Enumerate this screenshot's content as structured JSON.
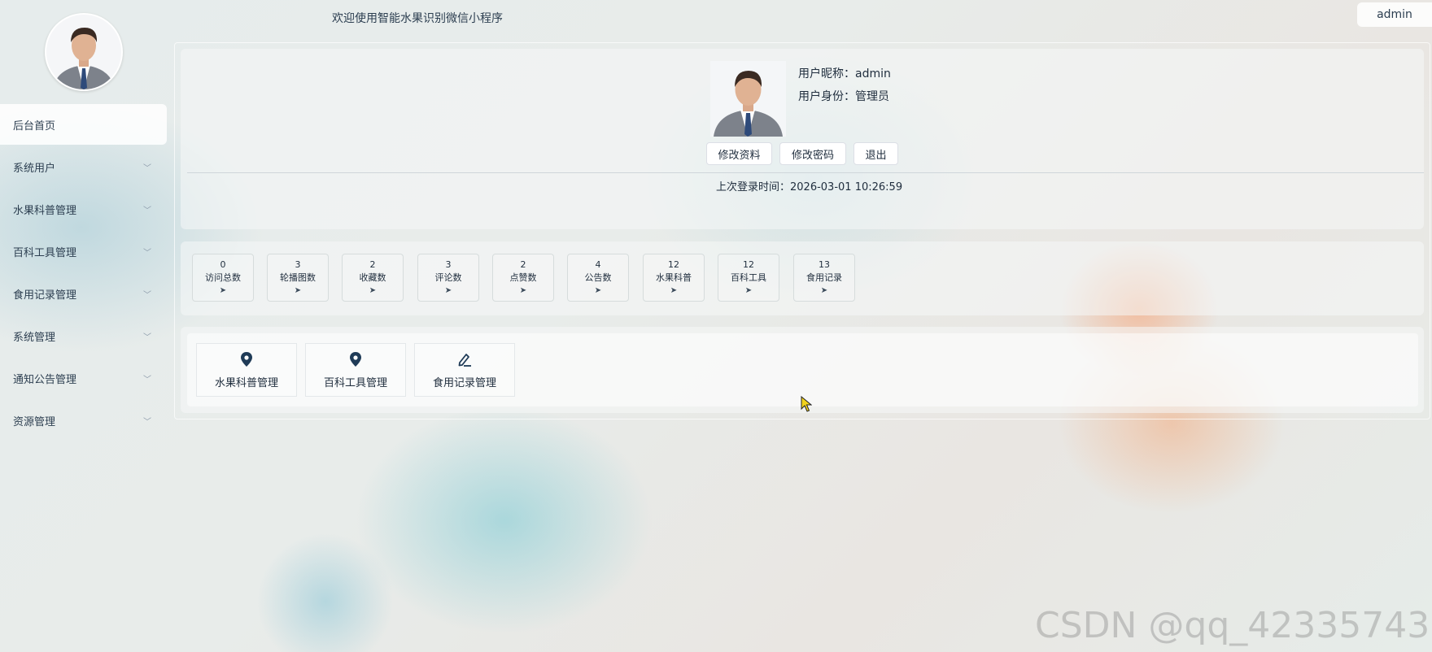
{
  "header": {
    "welcome": "欢迎使用智能水果识别微信小程序",
    "user": "admin"
  },
  "sidebar": {
    "items": [
      {
        "label": "后台首页",
        "active": true,
        "expandable": false
      },
      {
        "label": "系统用户",
        "expandable": true
      },
      {
        "label": "水果科普管理",
        "expandable": true
      },
      {
        "label": "百科工具管理",
        "expandable": true
      },
      {
        "label": "食用记录管理",
        "expandable": true
      },
      {
        "label": "系统管理",
        "expandable": true
      },
      {
        "label": "通知公告管理",
        "expandable": true
      },
      {
        "label": "资源管理",
        "expandable": true
      }
    ]
  },
  "profile": {
    "nickname_label": "用户昵称：",
    "nickname": "admin",
    "role_label": "用户身份：",
    "role": "管理员",
    "buttons": {
      "edit_profile": "修改资料",
      "change_password": "修改密码",
      "logout": "退出"
    },
    "last_login_label": "上次登录时间：",
    "last_login": "2026-03-01 10:26:59"
  },
  "stats": [
    {
      "value": "0",
      "label": "访问总数"
    },
    {
      "value": "3",
      "label": "轮播图数"
    },
    {
      "value": "2",
      "label": "收藏数"
    },
    {
      "value": "3",
      "label": "评论数"
    },
    {
      "value": "2",
      "label": "点赞数"
    },
    {
      "value": "4",
      "label": "公告数"
    },
    {
      "value": "12",
      "label": "水果科普"
    },
    {
      "value": "12",
      "label": "百科工具"
    },
    {
      "value": "13",
      "label": "食用记录"
    }
  ],
  "quick_links": [
    {
      "label": "水果科普管理",
      "icon": "location-pin-icon"
    },
    {
      "label": "百科工具管理",
      "icon": "location-pin-icon"
    },
    {
      "label": "食用记录管理",
      "icon": "edit-pen-icon"
    }
  ],
  "watermark": "CSDN @qq_42335743",
  "colors": {
    "accent": "#1f3b57",
    "text": "#1f2d3d"
  }
}
